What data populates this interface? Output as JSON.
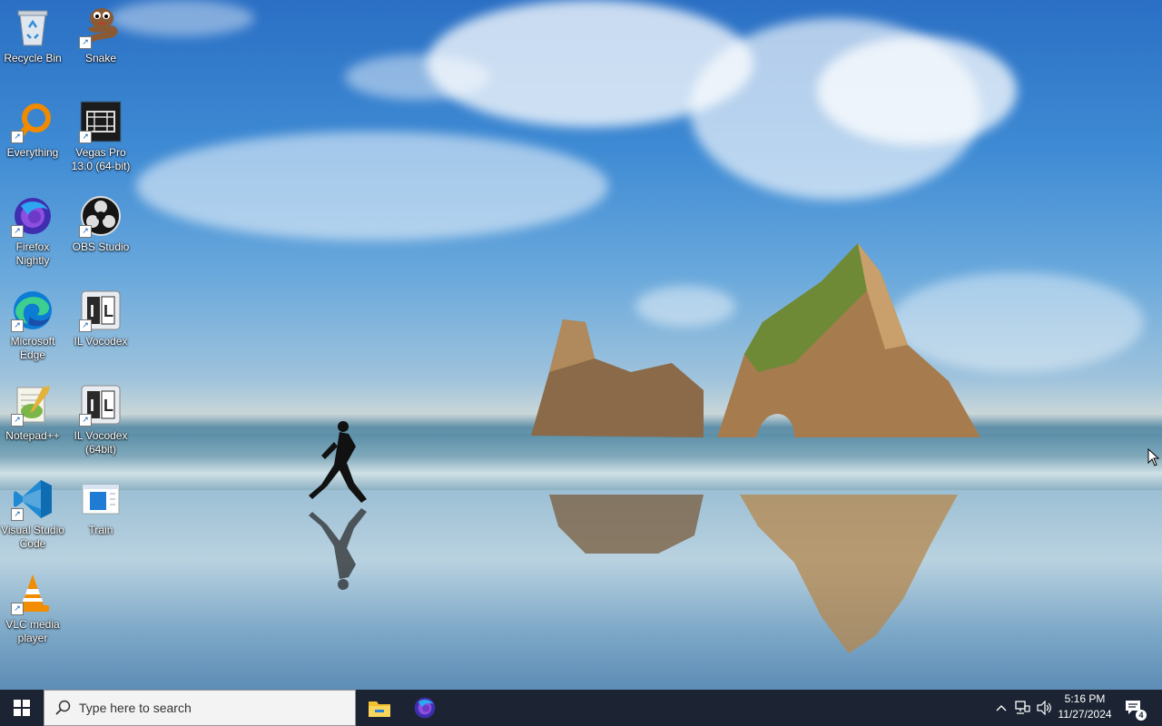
{
  "desktop": {
    "icons": [
      {
        "name": "recycle-bin",
        "label": "Recycle Bin"
      },
      {
        "name": "snake",
        "label": "Snake"
      },
      {
        "name": "everything",
        "label": "Everything"
      },
      {
        "name": "vegas-pro",
        "label": "Vegas Pro\n13.0 (64-bit)"
      },
      {
        "name": "firefox-nightly",
        "label": "Firefox\nNightly"
      },
      {
        "name": "obs-studio",
        "label": "OBS Studio"
      },
      {
        "name": "microsoft-edge",
        "label": "Microsoft\nEdge"
      },
      {
        "name": "il-vocodex",
        "label": "IL Vocodex"
      },
      {
        "name": "notepad-plus-plus",
        "label": "Notepad++"
      },
      {
        "name": "il-vocodex-64",
        "label": "IL Vocodex\n(64bit)"
      },
      {
        "name": "visual-studio-code",
        "label": "Visual Studio\nCode"
      },
      {
        "name": "train",
        "label": "Train"
      },
      {
        "name": "vlc-media-player",
        "label": "VLC media\nplayer"
      }
    ]
  },
  "taskbar": {
    "search_placeholder": "Type here to search",
    "apps": [
      "file-explorer-icon",
      "firefox-nightly-icon"
    ],
    "clock": {
      "time": "5:16 PM",
      "date": "11/27/2024"
    },
    "notification_count": "4"
  },
  "colors": {
    "taskbar": "#1c2433",
    "accent": "#0078d7"
  }
}
